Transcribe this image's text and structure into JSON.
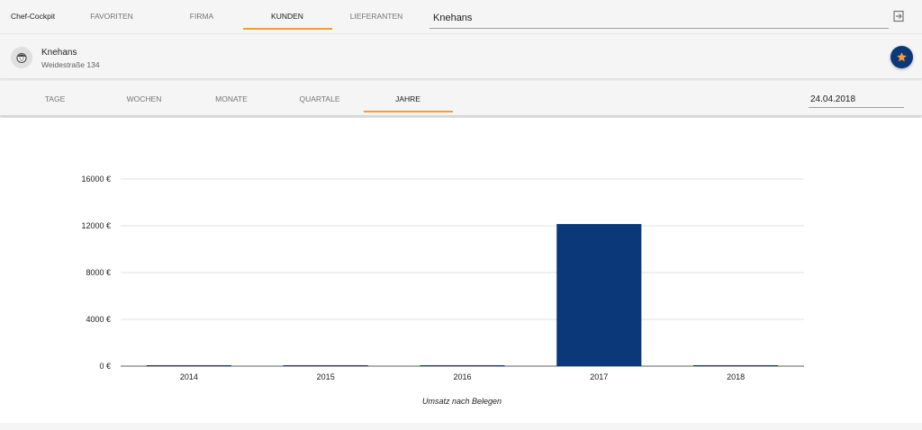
{
  "app": {
    "brand": "Chef-Cockpit"
  },
  "nav": {
    "tabs": [
      {
        "label": "FAVORITEN",
        "active": false
      },
      {
        "label": "FIRMA",
        "active": false
      },
      {
        "label": "KUNDEN",
        "active": true
      },
      {
        "label": "LIEFERANTEN",
        "active": false
      }
    ],
    "search": {
      "value": "Knehans"
    },
    "logout_icon": "logout-icon"
  },
  "customer": {
    "name": "Knehans",
    "address": "Weidestraße 134",
    "avatar_icon": "face-icon",
    "favorite_icon": "star-icon",
    "favorite_color": "#0a3879",
    "star_color": "#f39c39"
  },
  "periods": {
    "tabs": [
      {
        "label": "TAGE",
        "active": false
      },
      {
        "label": "WOCHEN",
        "active": false
      },
      {
        "label": "MONATE",
        "active": false
      },
      {
        "label": "QUARTALE",
        "active": false
      },
      {
        "label": "JAHRE",
        "active": true
      }
    ],
    "date": {
      "value": "24.04.2018"
    },
    "accent_color": "#f39c39"
  },
  "chart_data": {
    "type": "bar",
    "categories": [
      "2014",
      "2015",
      "2016",
      "2017",
      "2018"
    ],
    "values": [
      0,
      0,
      0,
      12150,
      0
    ],
    "yticks": [
      "0 €",
      "4000 €",
      "8000 €",
      "12000 €",
      "16000 €"
    ],
    "ytick_values": [
      0,
      4000,
      8000,
      12000,
      16000
    ],
    "ylim": [
      0,
      16000
    ],
    "xlabel": "Umsatz nach Belegen",
    "ylabel": "",
    "title": "",
    "bar_color": "#0a3879",
    "grid": true,
    "legend": "none"
  }
}
